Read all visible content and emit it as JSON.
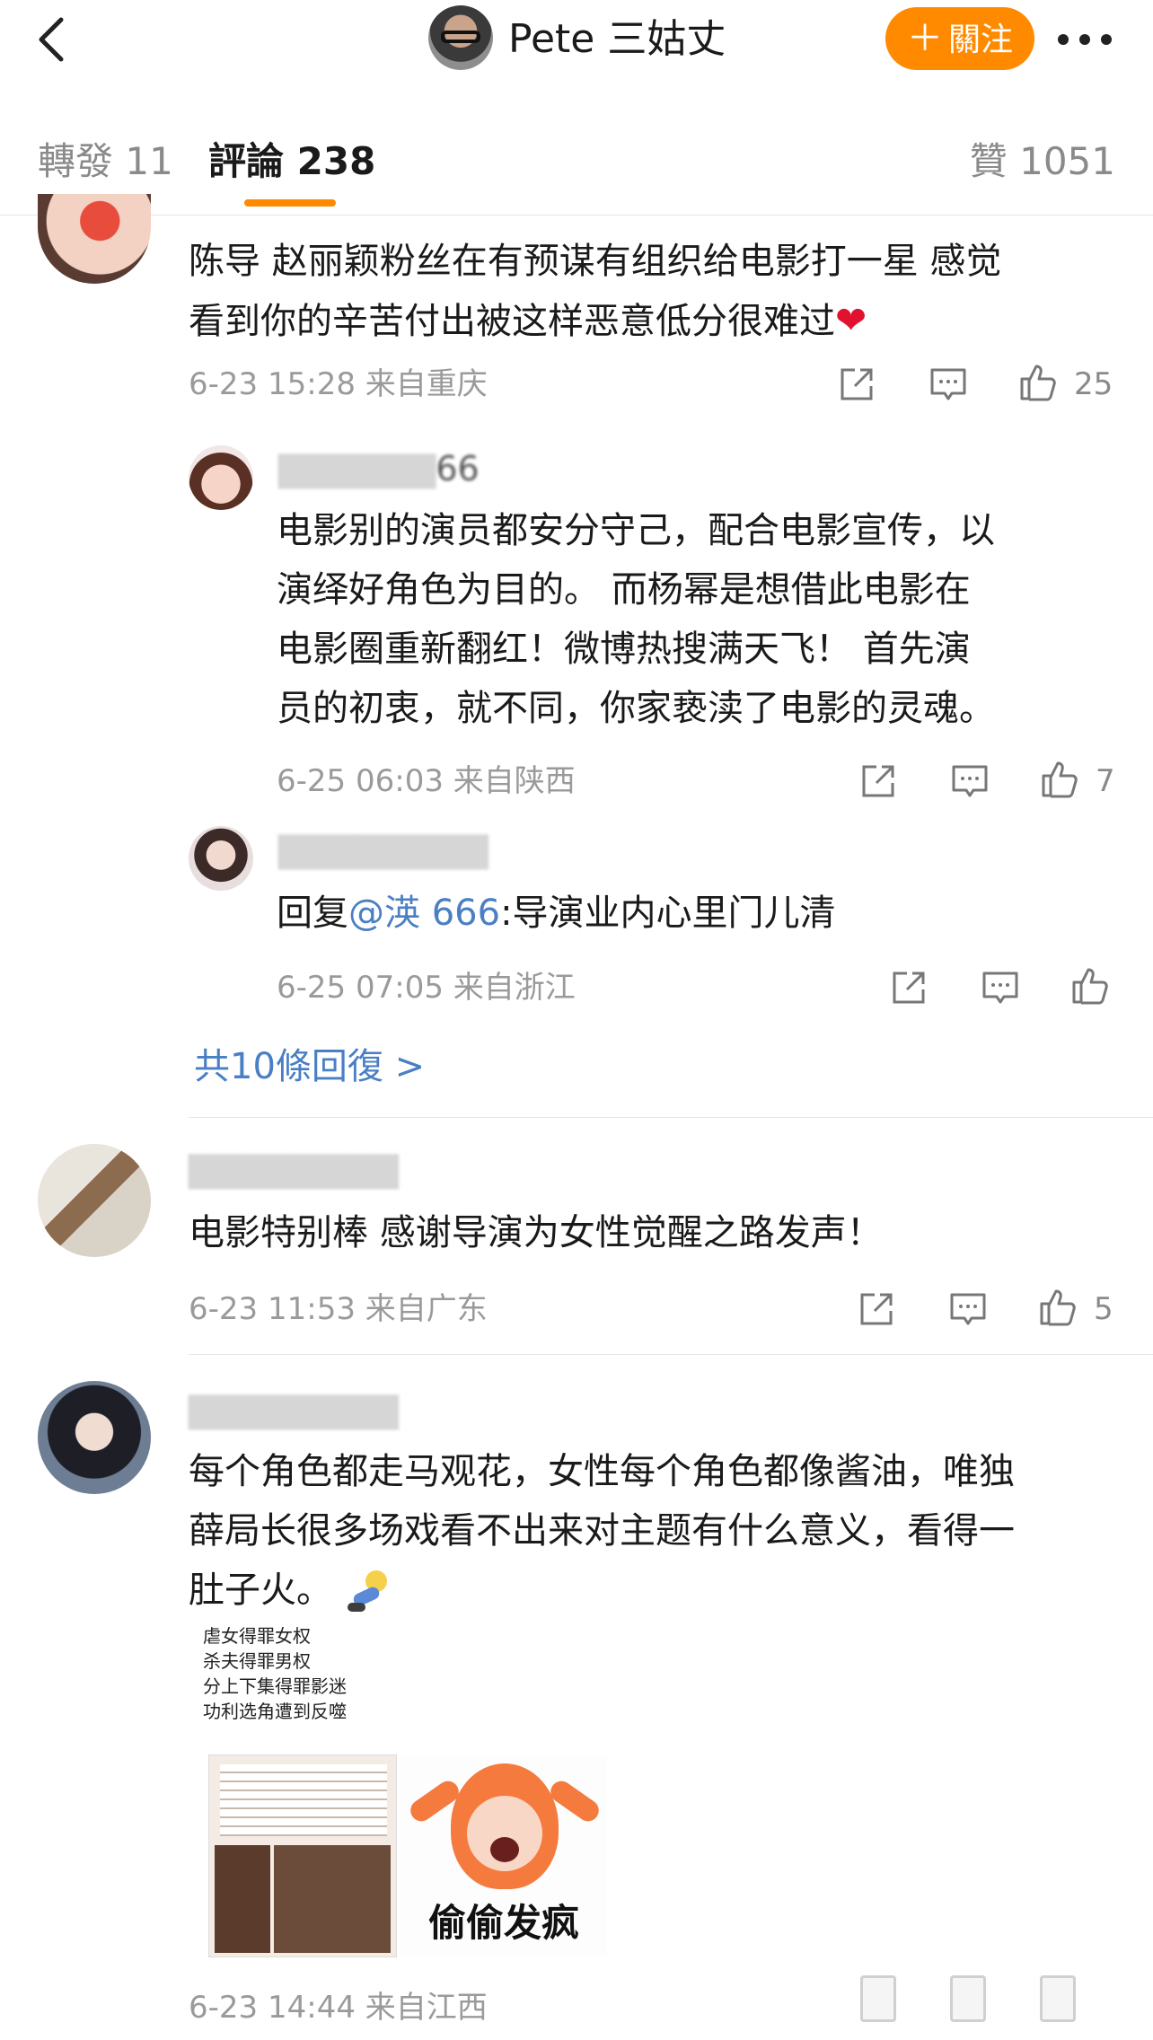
{
  "nav": {
    "title": "Pete 三姑丈",
    "follow_label": "關注"
  },
  "tabs": {
    "repost": "轉發 11",
    "comments": "評論 238",
    "likes": "贊 1051"
  },
  "comments": [
    {
      "text_line1": "陈导 赵丽颖粉丝在有预谋有组织给电影打一星  感觉",
      "text_line2": "看到你的辛苦付出被这样恶意低分很难过",
      "time": "6-23 15:28",
      "location": "来自重庆",
      "likes": "25"
    },
    {
      "text_line1": "电影特别棒 感谢导演为女性觉醒之路发声！",
      "time": "6-23 11:53",
      "location": "来自广东",
      "likes": "5"
    },
    {
      "text_line1": "每个角色都走马观花，女性每个角色都像酱油，唯独",
      "text_line2": "薛局长很多场戏看不出来对主题有什么意义，看得一",
      "text_line3": "肚子火。",
      "time": "6-23 14:44",
      "location": "来自江西",
      "attachment": {
        "lines": [
          "虐女得罪女权",
          "杀夫得罪男权",
          "分上下集得罪影迷",
          "功利选角遭到反噬"
        ],
        "sticker_caption": "偷偷发疯"
      }
    }
  ],
  "replies": [
    {
      "name_tail": "66",
      "text_line1": "电影别的演员都安分守己，配合电影宣传，以",
      "text_line2": "演绎好角色为目的。    而杨幂是想借此电影在",
      "text_line3": "电影圈重新翻红！微博热搜满天飞！     首先演",
      "text_line4": "员的初衷，就不同，你家亵渎了电影的灵魂。",
      "time": "6-25 06:03",
      "location": "来自陕西",
      "likes": "7"
    },
    {
      "reply_prefix": "回复",
      "mention": "@渶              666",
      "text": ":导演业内心里门儿清",
      "time": "6-25 07:05",
      "location": "来自浙江"
    }
  ],
  "more_replies": "共10條回復 >",
  "colors": {
    "accent": "#ff8a00",
    "link": "#4a7fc4",
    "meta": "#9a9a9a"
  }
}
